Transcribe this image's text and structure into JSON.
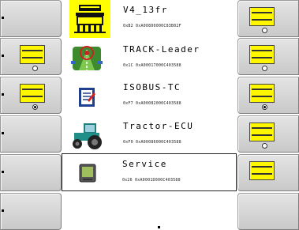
{
  "devices": [
    {
      "name": "V4_13fr",
      "id": "0xB2 0xA00800000C83B02F",
      "icon": "seeder-implement-icon"
    },
    {
      "name": "TRACK-Leader",
      "id": "0x1C 0xA00017000C403588",
      "icon": "track-leader-app-icon"
    },
    {
      "name": "ISOBUS-TC",
      "id": "0xF7 0xA00082000C403588",
      "icon": "isobus-tc-app-icon"
    },
    {
      "name": "Tractor-ECU",
      "id": "0xF0 0xA00086000C403588",
      "icon": "tractor-icon"
    },
    {
      "name": "Service",
      "id": "0x26 0xA0001D000C403588",
      "icon": "terminal-service-icon"
    }
  ],
  "colors": {
    "highlight": "#ffff00",
    "softkey": "#d6d6d6"
  }
}
